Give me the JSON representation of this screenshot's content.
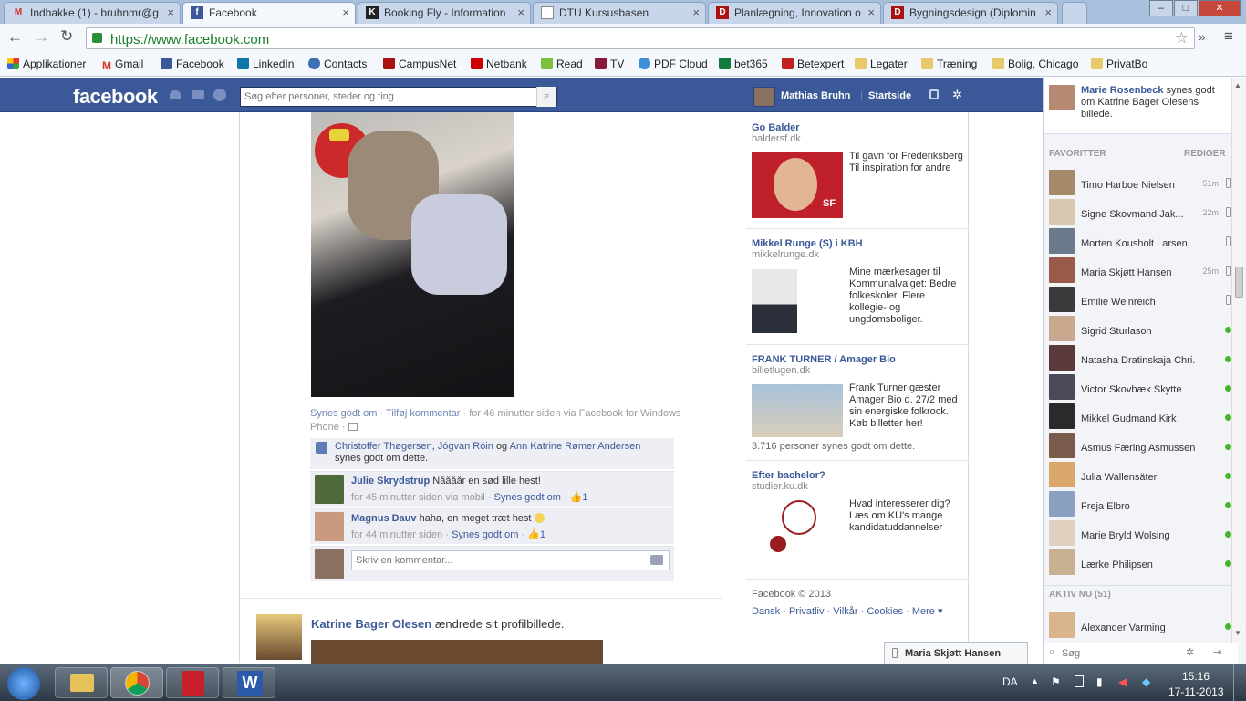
{
  "browser": {
    "tabs": [
      {
        "title": "Indbakke (1) - bruhnmr@g",
        "icon": "gmail-icon",
        "active": false
      },
      {
        "title": "Facebook",
        "icon": "facebook-icon",
        "active": true
      },
      {
        "title": "Booking Fly - Information",
        "icon": "k-icon",
        "active": false
      },
      {
        "title": "DTU Kursusbasen",
        "icon": "page-icon",
        "active": false
      },
      {
        "title": "Planlægning, Innovation o",
        "icon": "dtu-icon",
        "active": false
      },
      {
        "title": "Bygningsdesign (Diplomin",
        "icon": "dtu-icon",
        "active": false
      }
    ],
    "url": "https://www.facebook.com",
    "bookmarks": [
      "Applikationer",
      "Gmail",
      "Facebook",
      "LinkedIn",
      "Contacts",
      "CampusNet",
      "Netbank",
      "Read",
      "TV",
      "PDF Cloud",
      "bet365",
      "Betexpert",
      "Legater",
      "Træning",
      "Bolig, Chicago",
      "PrivatBo"
    ]
  },
  "fb": {
    "logo": "facebook",
    "search_placeholder": "Søg efter personer, steder og ting",
    "user_name": "Mathias Bruhn",
    "home": "Startside"
  },
  "post": {
    "actions": "Synes godt om · Tilføj kommentar",
    "meta": "· for 46 minutter siden via Facebook for Windows Phone ·",
    "likes_names_1": "Christoffer Thøgersen",
    "likes_names_2": "Jógvan Róin",
    "likes_og": "og",
    "likes_names_3": "Ann Katrine Rømer Andersen",
    "likes_suffix": "synes godt om dette.",
    "comments": [
      {
        "author": "Julie Skrydstrup",
        "text": "Nåååår en sød lille hest!",
        "meta": "for 45 minutter siden via mobil ·",
        "like": "Synes godt om",
        "count": "1"
      },
      {
        "author": "Magnus Dauv",
        "text": "haha, en meget træt hest",
        "meta": "for 44 minutter siden ·",
        "like": "Synes godt om",
        "count": "1"
      }
    ],
    "comment_placeholder": "Skriv en kommentar..."
  },
  "next_post": {
    "author": "Katrine Bager Olesen",
    "text": "ændrede sit profilbillede."
  },
  "ads": [
    {
      "title": "Go Balder",
      "domain": "baldersf.dk",
      "body": "Til gavn for Frederiksberg Til inspiration for andre"
    },
    {
      "title": "Mikkel Runge (S) i KBH",
      "domain": "mikkelrunge.dk",
      "body": "Mine mærkesager til Kommunalvalget: Bedre folkeskoler. Flere kollegie- og ungdomsboliger."
    },
    {
      "title": "FRANK TURNER / Amager Bio",
      "domain": "billetlugen.dk",
      "body": "Frank Turner gæster Amager Bio d. 27/2 med sin energiske folkrock. Køb billetter her!",
      "social": "3.716 personer synes godt om dette."
    },
    {
      "title": "Efter bachelor?",
      "domain": "studier.ku.dk",
      "body": "Hvad interesserer dig? Læs om KU's mange kandidatuddannelser"
    }
  ],
  "footer": {
    "copyright": "Facebook © 2013",
    "links": "Dansk · Privatliv · Vilkår · Cookies · Mere ▾"
  },
  "ticker": {
    "name": "Marie Rosenbeck",
    "text": "synes godt om Katrine Bager Olesens billede."
  },
  "chat": {
    "favorites_label": "FAVORITTER",
    "edit_label": "REDIGER",
    "active_label": "AKTIV NU (51)",
    "search_placeholder": "Søg",
    "favorites": [
      {
        "name": "Timo Harboe Nielsen",
        "time": "51m",
        "status": "mobile"
      },
      {
        "name": "Signe Skovmand Jak...",
        "time": "22m",
        "status": "mobile"
      },
      {
        "name": "Morten Kousholt Larsen",
        "time": "",
        "status": "mobile"
      },
      {
        "name": "Maria Skjøtt Hansen",
        "time": "25m",
        "status": "mobile"
      },
      {
        "name": "Emilie Weinreich",
        "time": "",
        "status": "mobile"
      },
      {
        "name": "Sigrid Sturlason",
        "time": "",
        "status": "online"
      },
      {
        "name": "Natasha Dratinskaja Chri...",
        "time": "",
        "status": "online"
      },
      {
        "name": "Victor Skovbæk Skytte",
        "time": "",
        "status": "online"
      },
      {
        "name": "Mikkel Gudmand Kirk",
        "time": "",
        "status": "online"
      },
      {
        "name": "Asmus Færing Asmussen",
        "time": "",
        "status": "online"
      },
      {
        "name": "Julia Wallensäter",
        "time": "",
        "status": "online"
      },
      {
        "name": "Freja Elbro",
        "time": "",
        "status": "online"
      },
      {
        "name": "Marie Bryld Wolsing",
        "time": "",
        "status": "online"
      },
      {
        "name": "Lærke Philipsen",
        "time": "",
        "status": "online"
      }
    ],
    "active": [
      {
        "name": "Alexander Varming",
        "status": "online"
      }
    ],
    "open_chat": "Maria Skjøtt Hansen"
  },
  "taskbar": {
    "lang": "DA",
    "time": "15:16",
    "date": "17-11-2013"
  }
}
